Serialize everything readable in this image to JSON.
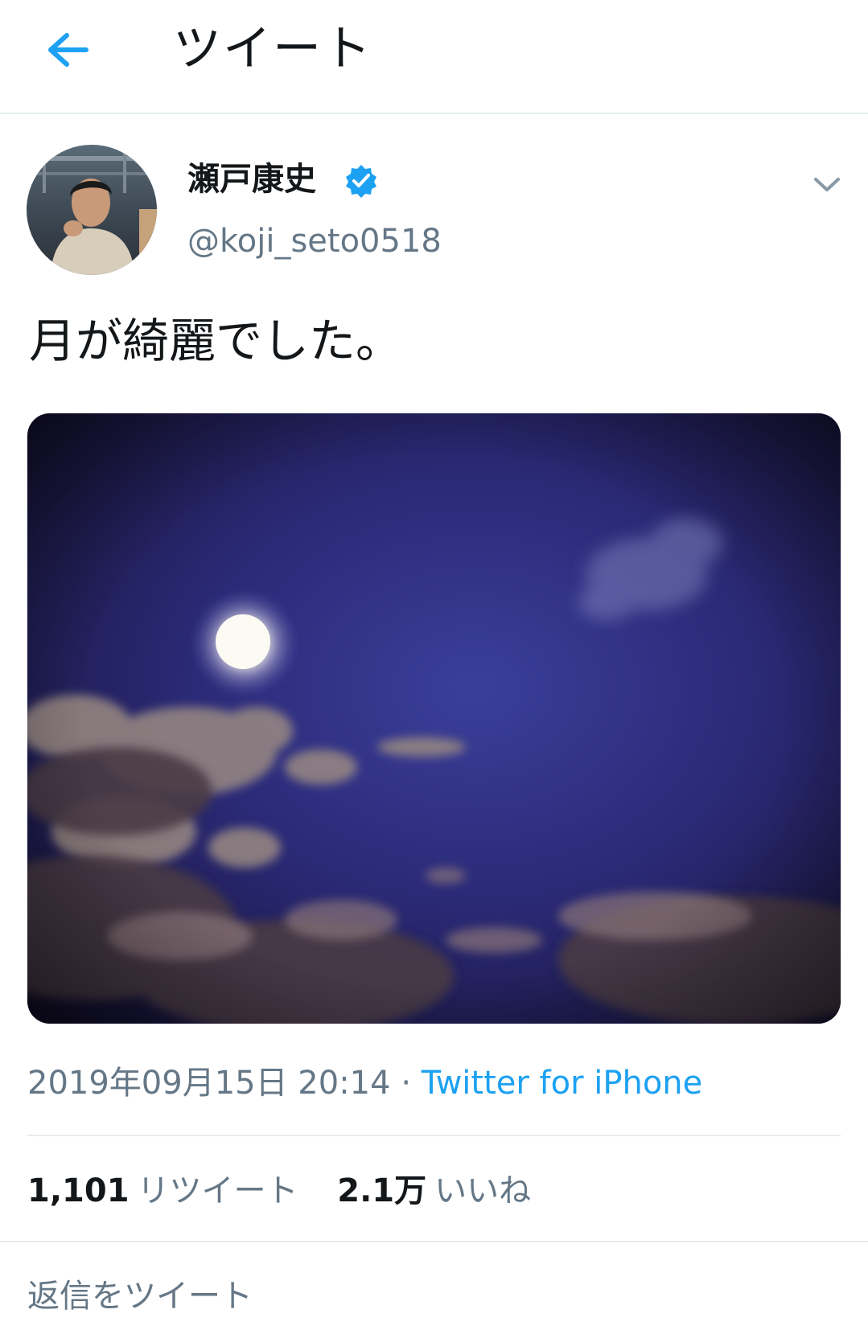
{
  "header": {
    "title": "ツイート",
    "back_icon": "arrow-left-icon"
  },
  "tweet": {
    "author": {
      "name": "瀬戸康史",
      "handle": "@koji_seto0518",
      "verified": true
    },
    "text": "月が綺麗でした。",
    "timestamp": "2019年09月15日 20:14",
    "separator": "·",
    "source": "Twitter for iPhone",
    "stats": {
      "retweets_count": "1,101",
      "retweets_label": "リツイート",
      "likes_count": "2.1万",
      "likes_label": "いいね"
    }
  },
  "reply": {
    "placeholder": "返信をツイート"
  },
  "colors": {
    "accent": "#1da1f2",
    "secondary_text": "#657786",
    "primary_text": "#14171a",
    "divider": "#e6ecf0"
  }
}
